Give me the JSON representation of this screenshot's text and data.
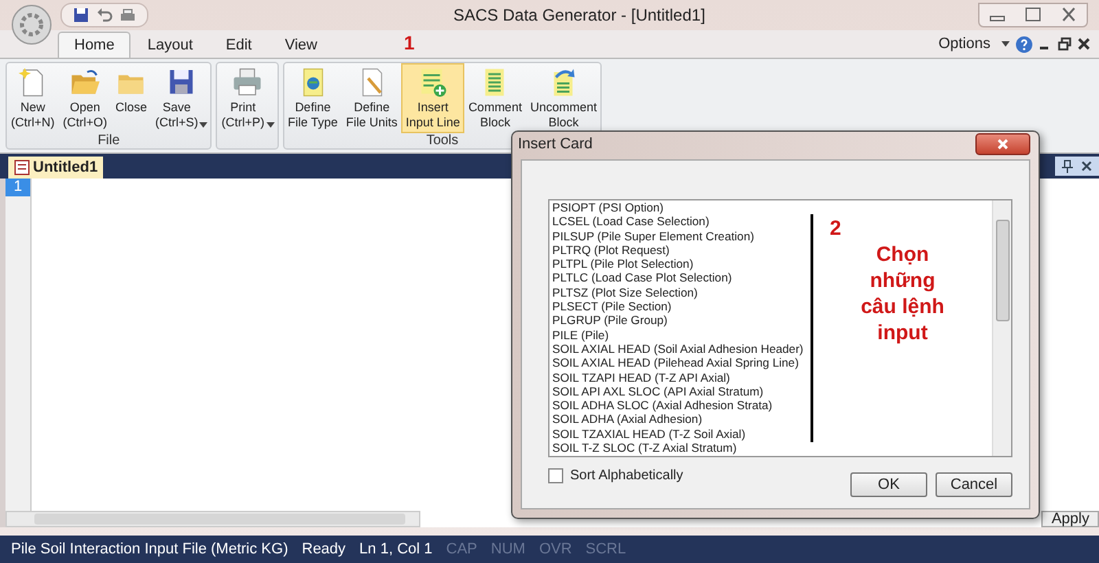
{
  "window": {
    "title": "SACS Data Generator - [Untitled1]"
  },
  "ribbon": {
    "tabs": [
      {
        "label": "Home",
        "selected": true
      },
      {
        "label": "Layout",
        "selected": false
      },
      {
        "label": "Edit",
        "selected": false
      },
      {
        "label": "View",
        "selected": false
      }
    ],
    "annotation": "1",
    "options": "Options",
    "groups": [
      {
        "label": "File",
        "buttons": [
          {
            "kind": "new",
            "lines": [
              "New",
              "(Ctrl+N)"
            ],
            "dropdown": false,
            "selected": false
          },
          {
            "kind": "open",
            "lines": [
              "Open",
              "(Ctrl+O)"
            ],
            "dropdown": false,
            "selected": false
          },
          {
            "kind": "close",
            "lines": [
              "Close"
            ],
            "dropdown": false,
            "selected": false
          },
          {
            "kind": "save",
            "lines": [
              "Save",
              "(Ctrl+S)"
            ],
            "dropdown": true,
            "selected": false
          }
        ]
      },
      {
        "buttons": [
          {
            "kind": "print",
            "lines": [
              "Print",
              "(Ctrl+P)"
            ],
            "dropdown": true,
            "selected": false
          }
        ]
      },
      {
        "label": "Tools",
        "buttons": [
          {
            "kind": "define-type",
            "lines": [
              "Define",
              "File Type"
            ],
            "dropdown": false,
            "selected": false
          },
          {
            "kind": "define-units",
            "lines": [
              "Define",
              "File Units"
            ],
            "dropdown": false,
            "selected": false
          },
          {
            "kind": "insert",
            "lines": [
              "Insert",
              "Input Line"
            ],
            "dropdown": false,
            "selected": true
          },
          {
            "kind": "comment",
            "lines": [
              "Comment",
              "Block"
            ],
            "dropdown": false,
            "selected": false
          },
          {
            "kind": "uncomment",
            "lines": [
              "Uncomment",
              "Block"
            ],
            "dropdown": false,
            "selected": false
          }
        ]
      }
    ]
  },
  "document": {
    "tabs": [
      {
        "label": "Untitled1",
        "selected": true
      }
    ],
    "line_numbers": [
      "1"
    ],
    "buttons": [
      "Apply"
    ]
  },
  "dialog": {
    "title": "Insert Card",
    "items": [
      "PSIOPT (PSI Option)",
      "LCSEL (Load Case Selection)",
      "PILSUP (Pile Super Element Creation)",
      "PLTRQ (Plot Request)",
      "PLTPL (Pile Plot Selection)",
      "PLTLC (Load Case Plot Selection)",
      "PLTSZ (Plot Size Selection)",
      "PLSECT (Pile Section)",
      "PLGRUP (Pile Group)",
      "PILE (Pile)",
      "SOIL AXIAL HEAD (Soil Axial Adhesion Header)",
      "SOIL AXIAL HEAD (Pilehead Axial Spring Line)",
      "SOIL TZAPI HEAD (T-Z API Axial)",
      "SOIL API AXL SLOC (API Axial Stratum)",
      "SOIL ADHA SLOC (Axial Adhesion Strata)",
      "SOIL ADHA (Axial Adhesion)",
      "SOIL TZAXIAL HEAD (T-Z Soil Axial)",
      "SOIL T-Z SLOC (T-Z Axial Stratum)"
    ],
    "annotation": {
      "number": "2",
      "text": "Chọn những câu lệnh input"
    },
    "checkbox": {
      "label": "Sort Alphabetically",
      "checked": false
    },
    "buttons": [
      "OK",
      "Cancel"
    ]
  },
  "status_bar": [
    {
      "text": "Pile Soil Interaction Input File (Metric KG)",
      "disabled": false
    },
    {
      "text": "Ready",
      "disabled": false
    },
    {
      "text": "Ln 1, Col 1",
      "disabled": false
    },
    {
      "text": "CAP",
      "disabled": true
    },
    {
      "text": "NUM",
      "disabled": true
    },
    {
      "text": "OVR",
      "disabled": true
    },
    {
      "text": "SCRL",
      "disabled": true
    }
  ]
}
